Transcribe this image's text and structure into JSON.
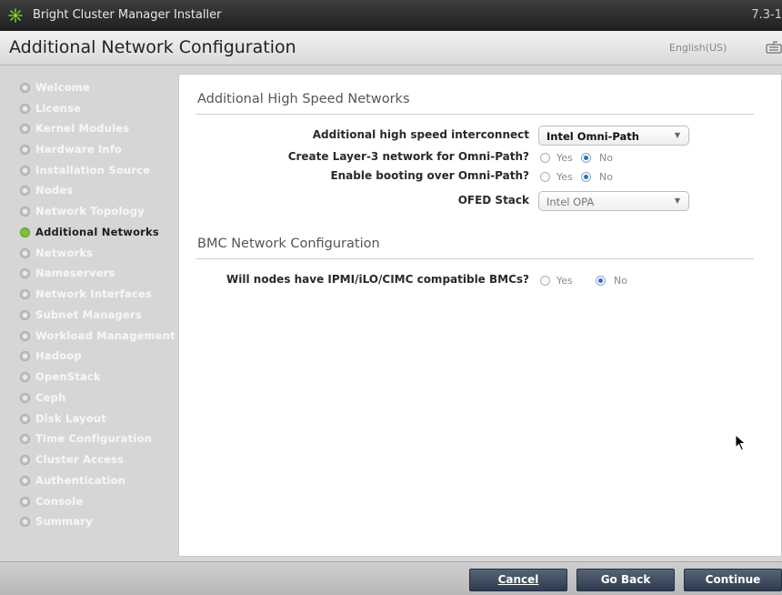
{
  "window": {
    "title": "Bright Cluster Manager Installer",
    "version": "7.3-1"
  },
  "header": {
    "page_title": "Additional Network Configuration",
    "language": "English(US)"
  },
  "sidebar": {
    "items": [
      {
        "label": "Welcome"
      },
      {
        "label": "License"
      },
      {
        "label": "Kernel Modules"
      },
      {
        "label": "Hardware Info"
      },
      {
        "label": "Installation Source"
      },
      {
        "label": "Nodes"
      },
      {
        "label": "Network Topology"
      },
      {
        "label": "Additional Networks",
        "active": true
      },
      {
        "label": "Networks"
      },
      {
        "label": "Nameservers"
      },
      {
        "label": "Network Interfaces"
      },
      {
        "label": "Subnet Managers"
      },
      {
        "label": "Workload Management"
      },
      {
        "label": "Hadoop"
      },
      {
        "label": "OpenStack"
      },
      {
        "label": "Ceph"
      },
      {
        "label": "Disk Layout"
      },
      {
        "label": "Time Configuration"
      },
      {
        "label": "Cluster Access"
      },
      {
        "label": "Authentication"
      },
      {
        "label": "Console"
      },
      {
        "label": "Summary"
      }
    ]
  },
  "high_speed": {
    "section_title": "Additional High Speed Networks",
    "interconnect_label": "Additional high speed interconnect",
    "interconnect_value": "Intel Omni-Path",
    "layer3_label": "Create Layer-3 network for Omni-Path?",
    "layer3_value": "No",
    "boot_label": "Enable booting over Omni-Path?",
    "boot_value": "No",
    "ofed_label": "OFED Stack",
    "ofed_value": "Intel OPA",
    "yes_label": "Yes",
    "no_label": "No"
  },
  "bmc": {
    "section_title": "BMC Network Configuration",
    "question_label": "Will nodes have IPMI/iLO/CIMC compatible BMCs?",
    "value": "No"
  },
  "footer": {
    "cancel_label": "Cancel",
    "back_label": "Go Back",
    "continue_label": "Continue"
  },
  "colors": {
    "titlebar": "#2f2f2f",
    "active_step_dot": "#7fc23a",
    "button": "#3e4a5d",
    "radio_selected": "#2e6fc4"
  }
}
